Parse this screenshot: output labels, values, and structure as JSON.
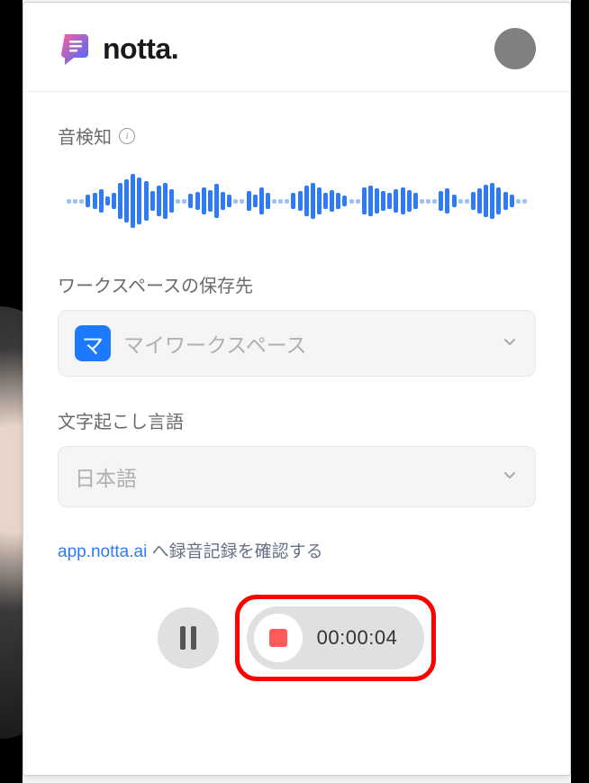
{
  "brand": {
    "name": "notta."
  },
  "labels": {
    "audio_detect": "音検知",
    "workspace_dest": "ワークスペースの保存先",
    "transcription_lang": "文字起こし言語"
  },
  "workspace": {
    "badge_char": "マ",
    "selected": "マイワークスペース"
  },
  "language": {
    "selected": "日本語"
  },
  "link": {
    "url_text": "app.notta.ai",
    "suffix": " へ録音記録を確認する"
  },
  "recording": {
    "time": "00:00:04"
  },
  "waveform_heights": [
    5,
    5,
    5,
    14,
    18,
    26,
    10,
    18,
    40,
    48,
    60,
    52,
    44,
    22,
    34,
    40,
    26,
    5,
    5,
    16,
    20,
    30,
    24,
    38,
    20,
    14,
    5,
    5,
    22,
    14,
    30,
    18,
    5,
    5,
    5,
    18,
    22,
    34,
    40,
    30,
    18,
    24,
    18,
    12,
    5,
    5,
    30,
    34,
    28,
    22,
    18,
    26,
    30,
    24,
    18,
    5,
    5,
    5,
    22,
    28,
    14,
    5,
    5,
    20,
    28,
    36,
    40,
    30,
    20,
    14,
    5,
    5
  ]
}
